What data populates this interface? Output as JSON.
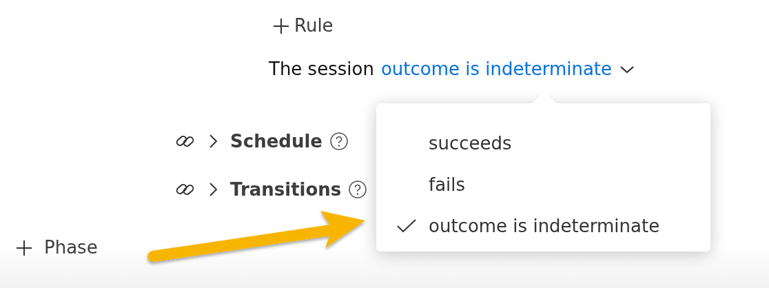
{
  "add_rule": {
    "label": "Rule"
  },
  "condition": {
    "prefix": "The session",
    "value": "outcome is indeterminate"
  },
  "sections": [
    {
      "label": "Schedule",
      "expanded": false
    },
    {
      "label": "Transitions",
      "expanded": false
    }
  ],
  "dropdown": {
    "options": [
      {
        "label": "succeeds",
        "selected": false
      },
      {
        "label": "fails",
        "selected": false
      },
      {
        "label": "outcome is indeterminate",
        "selected": true
      }
    ]
  },
  "add_phase": {
    "label": "Phase"
  }
}
